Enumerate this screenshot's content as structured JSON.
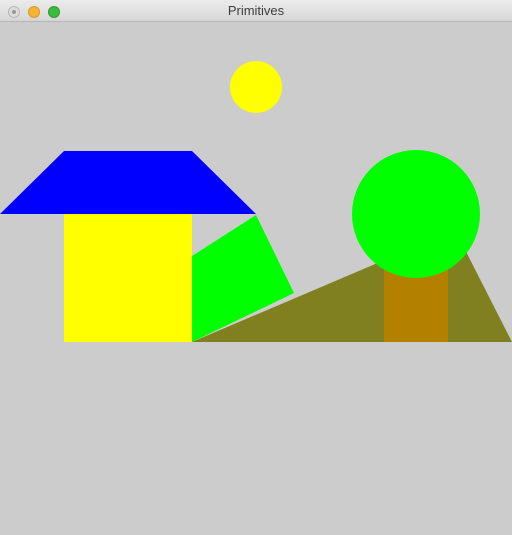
{
  "window": {
    "title": "Primitives",
    "background": "#cccccc"
  },
  "colors": {
    "sun": "#ffff00",
    "roof": "#0000ff",
    "house": "#ffff00",
    "slope": "#00ff00",
    "hill": "#808020",
    "trunk": "#b38000",
    "tree_canopy": "#00ff00"
  }
}
